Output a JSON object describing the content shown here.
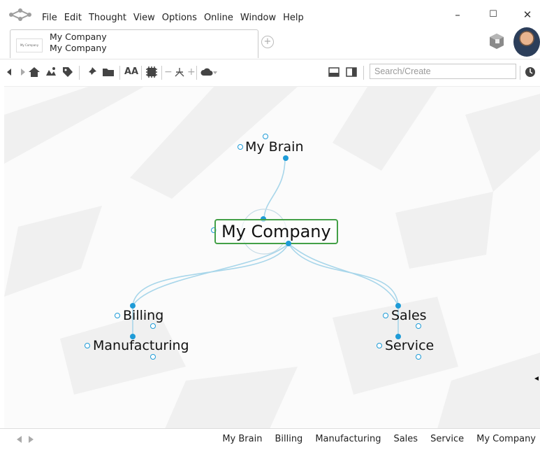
{
  "menu": [
    "File",
    "Edit",
    "Thought",
    "View",
    "Options",
    "Online",
    "Window",
    "Help"
  ],
  "window_controls": {
    "minimize": "–",
    "maximize": "☐",
    "close": "✕"
  },
  "tab": {
    "thumb": "My Company",
    "title": "My Company",
    "subtitle": "My Company"
  },
  "new_tab_symbol": "+",
  "toolbar": {
    "icons": [
      "back-icon",
      "forward-icon",
      "home-icon",
      "pins-icon",
      "tag-icon",
      "pin-icon",
      "folder-icon",
      "font-size-icon",
      "ai-icon",
      "minus-icon",
      "layout-icon",
      "plus-icon",
      "cloud-icon",
      "cloud-dropdown-icon",
      "split-bottom-icon",
      "split-right-icon",
      "history-icon"
    ],
    "font_label": "AA",
    "search_placeholder": "Search/Create"
  },
  "mindmap": {
    "central": "My Company",
    "parent": "My Brain",
    "children": [
      "Billing",
      "Manufacturing",
      "Sales",
      "Service"
    ]
  },
  "breadcrumbs": [
    "My Brain",
    "Billing",
    "Manufacturing",
    "Sales",
    "Service",
    "My Company"
  ],
  "colors": {
    "accent": "#1e9bd7",
    "central_border": "#43a047",
    "link": "#a8d6ea"
  }
}
